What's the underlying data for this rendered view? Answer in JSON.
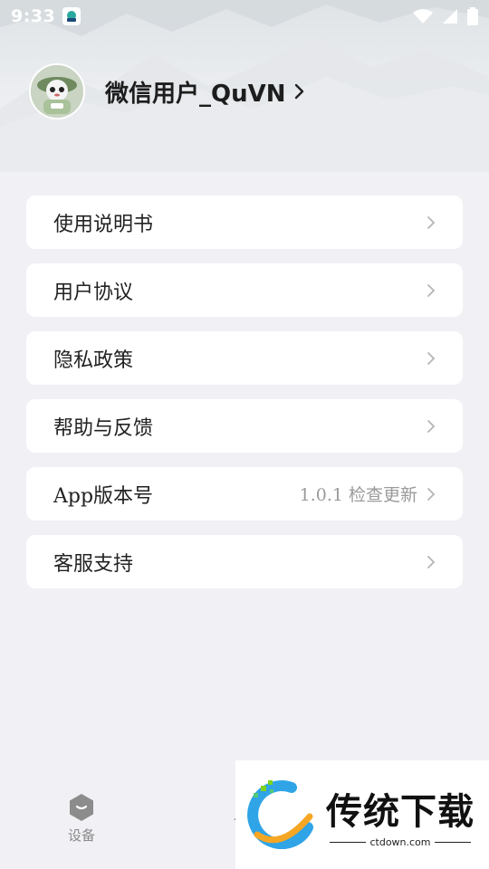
{
  "status_bar": {
    "time": "9:33"
  },
  "profile": {
    "username": "微信用户_QuVN"
  },
  "menu": {
    "items": [
      {
        "label": "使用说明书",
        "extra": ""
      },
      {
        "label": "用户协议",
        "extra": ""
      },
      {
        "label": "隐私政策",
        "extra": ""
      },
      {
        "label": "帮助与反馈",
        "extra": ""
      },
      {
        "label": "App版本号",
        "extra": "1.0.1 检查更新"
      },
      {
        "label": "客服支持",
        "extra": ""
      }
    ]
  },
  "bottom_nav": {
    "tabs": [
      {
        "label": "设备",
        "icon": "device-icon"
      }
    ]
  },
  "watermark": {
    "title": "传统下载",
    "subtitle": "ctdown.com"
  },
  "colors": {
    "background": "#f1f1f5",
    "card": "#ffffff",
    "muted_text": "#9a9a9a"
  }
}
